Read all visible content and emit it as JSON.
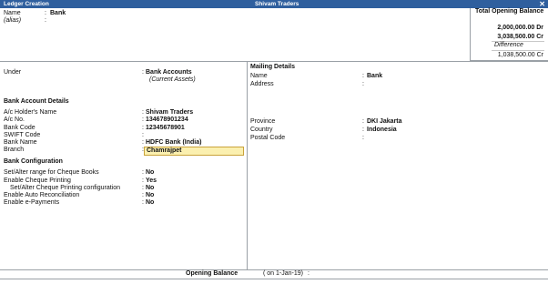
{
  "window": {
    "title": "Ledger Creation",
    "company": "Shivam Traders",
    "close_glyph": "✕"
  },
  "header": {
    "name_label": "Name",
    "name_value": "Bank",
    "alias_label": "(alias)",
    "colon": ":"
  },
  "opening_panel": {
    "title": "Total Opening Balance",
    "dr_amount": "2,000,000.00 Dr",
    "cr_amount": "3,038,500.00 Cr",
    "difference_label": "Difference",
    "difference_amount": "1,038,500.00 Cr"
  },
  "under": {
    "label": "Under",
    "value": "Bank Accounts",
    "sub": "(Current Assets)"
  },
  "bank_account_details": {
    "heading": "Bank Account Details",
    "fields": [
      {
        "label": "A/c Holder's Name",
        "value": "Shivam Traders"
      },
      {
        "label": "A/c No.",
        "value": "134678901234"
      },
      {
        "label": "Bank Code",
        "value": "12345678901"
      },
      {
        "label": "SWIFT Code",
        "value": ""
      },
      {
        "label": "Bank Name",
        "value": "HDFC Bank (India)"
      },
      {
        "label": "Branch",
        "value": "Chamrajpet"
      }
    ]
  },
  "bank_configuration": {
    "heading": "Bank Configuration",
    "fields": [
      {
        "label": "Set/Alter range for Cheque Books",
        "value": "No"
      },
      {
        "label": "Enable Cheque Printing",
        "value": "Yes"
      },
      {
        "label": "Set/Alter Cheque Printing configuration",
        "value": "No"
      },
      {
        "label": "Enable Auto Reconciliation",
        "value": "No"
      },
      {
        "label": "Enable e-Payments",
        "value": "No"
      }
    ]
  },
  "mailing": {
    "heading": "Mailing Details",
    "name_label": "Name",
    "name_value": "Bank",
    "address_label": "Address",
    "province_label": "Province",
    "province_value": "DKI Jakarta",
    "country_label": "Country",
    "country_value": "Indonesia",
    "postal_label": "Postal Code"
  },
  "footer": {
    "opening_label": "Opening Balance",
    "date_text": "( on 1-Jan-19)",
    "colon": ":"
  }
}
